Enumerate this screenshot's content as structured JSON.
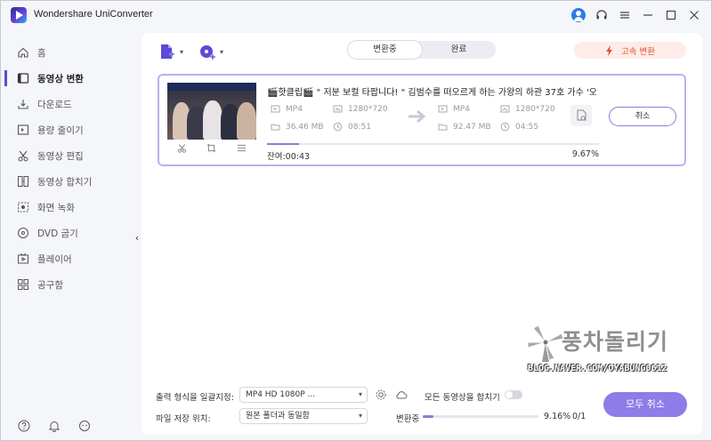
{
  "app": {
    "title": "Wondershare UniConverter"
  },
  "sidebar": {
    "items": [
      {
        "label": "홈",
        "icon": "home-icon"
      },
      {
        "label": "동영상 변환",
        "icon": "convert-icon",
        "active": true
      },
      {
        "label": "다운로드",
        "icon": "download-icon"
      },
      {
        "label": "용량 줄이기",
        "icon": "compress-icon"
      },
      {
        "label": "동영상 편집",
        "icon": "scissors-icon"
      },
      {
        "label": "동영상 합치기",
        "icon": "merge-icon"
      },
      {
        "label": "화면 녹화",
        "icon": "record-icon"
      },
      {
        "label": "DVD 굽기",
        "icon": "disc-icon"
      },
      {
        "label": "플레이어",
        "icon": "player-icon"
      },
      {
        "label": "공구함",
        "icon": "toolbox-icon"
      }
    ]
  },
  "tabs": {
    "converting": "변환중",
    "done": "완료"
  },
  "fast_convert": "고속 변환",
  "task": {
    "title": "🎬핫클립🎬 \" 저분 보컬 타팝니다! \" 김범수를 떠오르게 하는 가왕의 하관 37호 가수 '오...",
    "source": {
      "format": "MP4",
      "resolution": "1280*720",
      "size": "36.46 MB",
      "duration": "08:51"
    },
    "target": {
      "format": "MP4",
      "resolution": "1280*720",
      "size": "92.47 MB",
      "duration": "04:55"
    },
    "cancel_label": "취소",
    "remaining": "잔여:00:43",
    "percent_text": "9.67%",
    "progress": 0.0967
  },
  "bottom": {
    "output_format_label": "출력 형식을 일괄지정:",
    "output_format_value": "MP4 HD 1080P ...",
    "merge_label": "모든 동영상을 합치기",
    "merge_enabled": false,
    "save_location_label": "파일 저장 위치:",
    "save_location_value": "원본 폴더과 동일함",
    "status_label": "변환중",
    "overall_percent_text": "9.16%",
    "overall_progress": 0.0916,
    "count_text": "0/1",
    "cancel_all_label": "모두 취소"
  },
  "watermark": {
    "title": "풍차돌리기",
    "url": "BLOG.NAVER.COM/OYABUNG0612"
  },
  "colors": {
    "accent": "#8e7ce8",
    "fast": "#e24f2a",
    "active_bar": "#5b4bd6"
  }
}
